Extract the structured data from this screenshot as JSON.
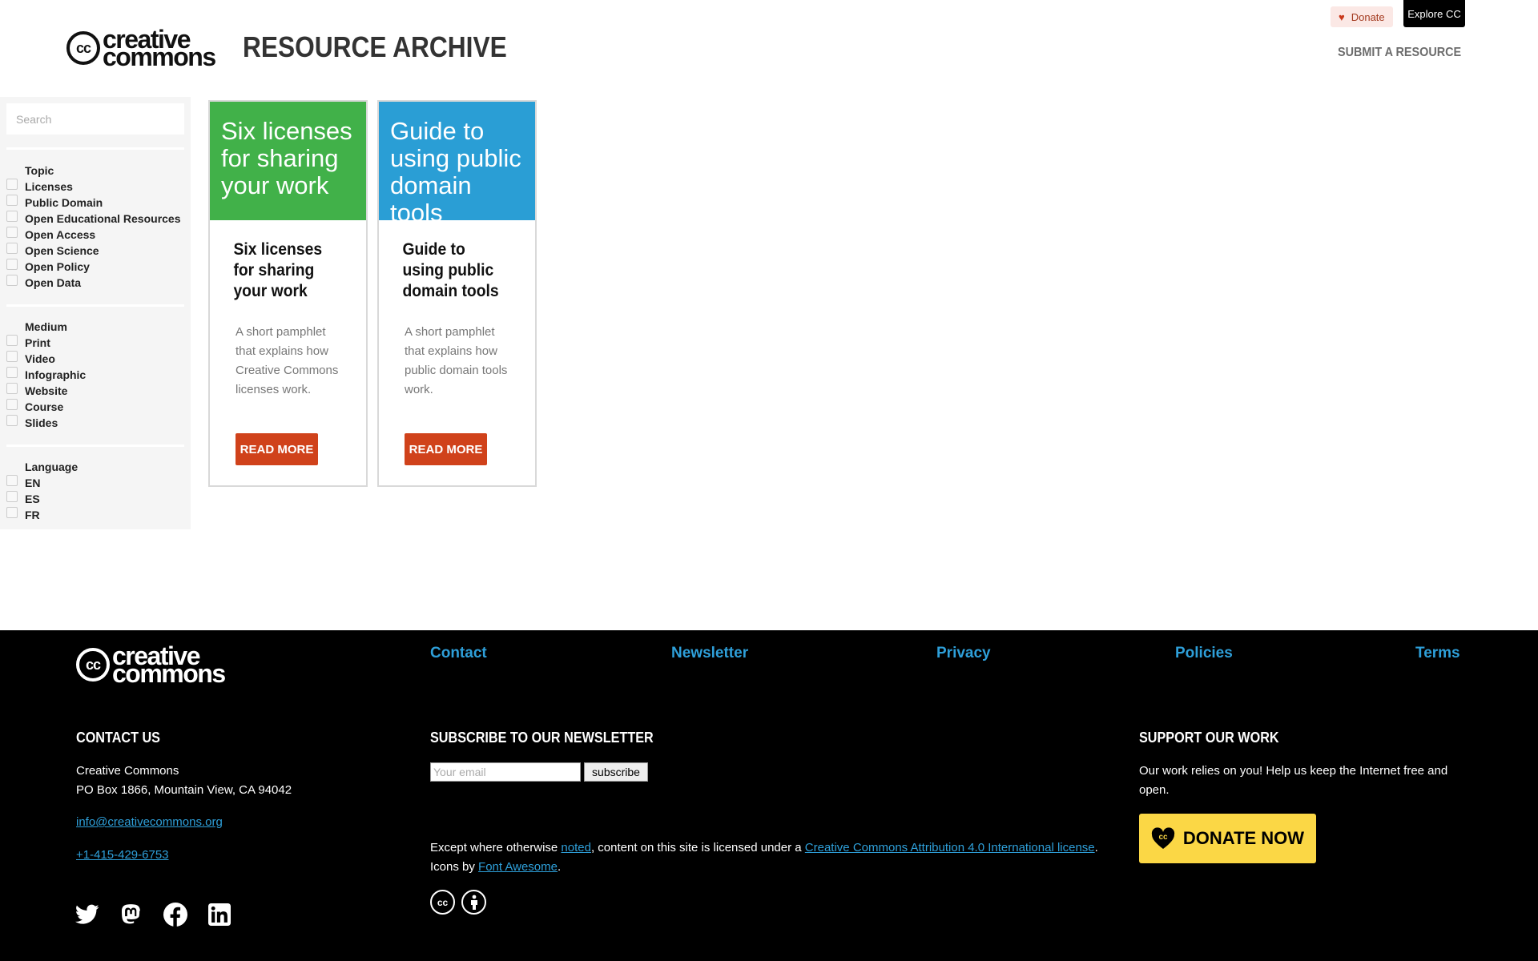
{
  "header": {
    "logo_line1": "creative",
    "logo_line2": "commons",
    "logo_cc": "cc",
    "site_title": "RESOURCE ARCHIVE",
    "donate_label": "Donate",
    "explore_label": "Explore CC",
    "submit_label": "SUBMIT A RESOURCE"
  },
  "sidebar": {
    "search_placeholder": "Search",
    "groups": [
      {
        "title": "Topic",
        "items": [
          "Licenses",
          "Public Domain",
          "Open Educational Resources",
          "Open Access",
          "Open Science",
          "Open Policy",
          "Open Data"
        ]
      },
      {
        "title": "Medium",
        "items": [
          "Print",
          "Video",
          "Infographic",
          "Website",
          "Course",
          "Slides"
        ]
      },
      {
        "title": "Language",
        "items": [
          "EN",
          "ES",
          "FR"
        ]
      }
    ]
  },
  "cards": [
    {
      "hero": "Six licenses for sharing your work",
      "hero_color": "#41b149",
      "title": "Six licenses for sharing your work",
      "description": "A short pamphlet that explains how Creative Commons licenses work.",
      "button": "READ MORE"
    },
    {
      "hero": "Guide to using public domain tools",
      "hero_color": "#2a9ed5",
      "title": "Guide to using public domain tools",
      "description": "A short pamphlet that explains how public domain tools work.",
      "button": "READ MORE"
    }
  ],
  "footer": {
    "logo_line1": "creative",
    "logo_line2": "commons",
    "logo_cc": "cc",
    "nav": [
      "Contact",
      "Newsletter",
      "Privacy",
      "Policies",
      "Terms"
    ],
    "contact": {
      "heading": "CONTACT US",
      "org": "Creative Commons",
      "address": "PO Box 1866, Mountain View, CA 94042",
      "email": "info@creativecommons.org",
      "phone": "+1-415-429-6753"
    },
    "newsletter": {
      "heading": "SUBSCRIBE TO OUR NEWSLETTER",
      "placeholder": "Your email",
      "button": "subscribe"
    },
    "license": {
      "prefix": "Except where otherwise ",
      "noted": "noted",
      "middle": ", content on this site is licensed under a ",
      "license_link": "Creative Commons Attribution 4.0 International license",
      "end": ".",
      "icons_prefix": "Icons by ",
      "icons_link": "Font Awesome",
      "icons_end": "."
    },
    "support": {
      "heading": "SUPPORT OUR WORK",
      "text": "Our work relies on you! Help us keep the Internet free and open.",
      "button": "DONATE NOW"
    },
    "social_icons": [
      "twitter-icon",
      "mastodon-icon",
      "facebook-icon",
      "linkedin-icon"
    ],
    "accent_color": "#2e9fd9"
  }
}
